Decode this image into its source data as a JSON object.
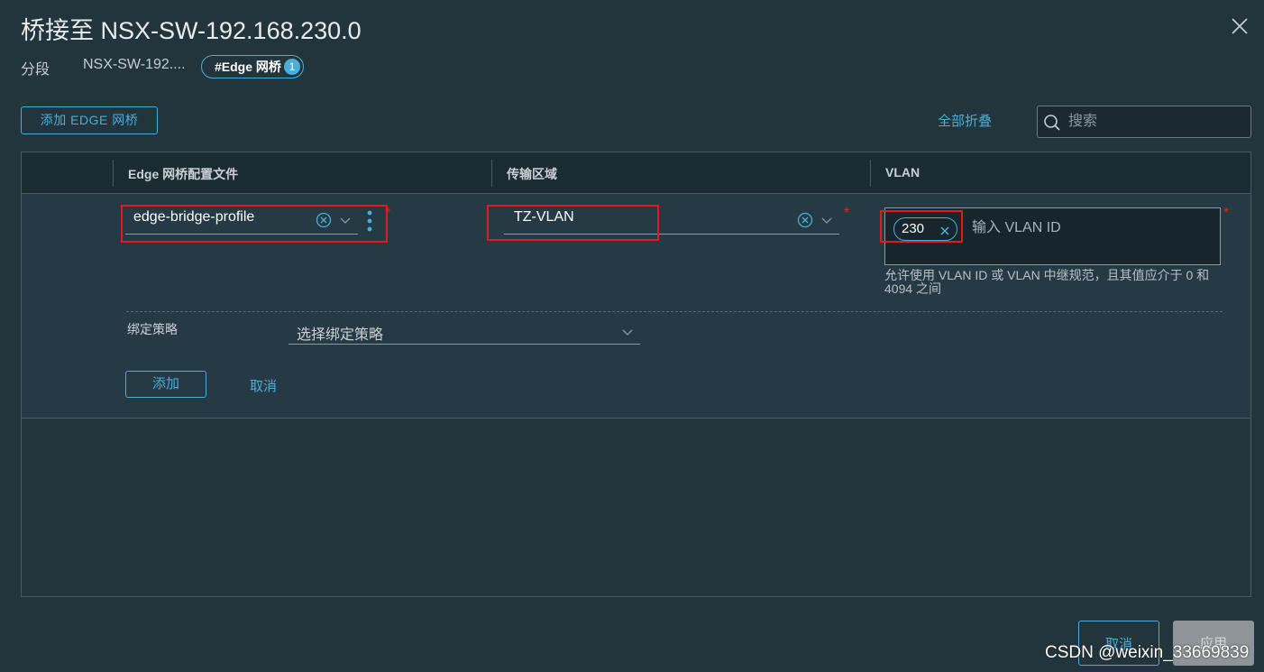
{
  "dialog": {
    "title": "桥接至 NSX-SW-192.168.230.0",
    "close_icon": "close-icon"
  },
  "breadcrumb": {
    "segment_label": "分段",
    "segment_name": "NSX-SW-192....",
    "tab_label": "#Edge 网桥",
    "tab_count": "1"
  },
  "toolbar": {
    "add_bridge_label": "添加 EDGE 网桥",
    "collapse_all_label": "全部折叠",
    "search_placeholder": "搜索"
  },
  "grid": {
    "columns": [
      "Edge 网桥配置文件",
      "传输区域",
      "VLAN"
    ]
  },
  "form": {
    "edge_profile_value": "edge-bridge-profile",
    "transport_zone_value": "TZ-VLAN",
    "vlan_tag": "230",
    "vlan_placeholder": "输入 VLAN ID",
    "vlan_help": "允许使用 VLAN ID 或 VLAN 中继规范，且其值应介于 0 和 4094 之间",
    "binding_policy_label": "绑定策略",
    "binding_policy_placeholder": "选择绑定策略",
    "add_label": "添加",
    "cancel_label": "取消",
    "required_mark": "*"
  },
  "footer": {
    "cancel_label": "取消",
    "apply_label": "应用"
  },
  "watermark": "CSDN @weixin_33669839",
  "colors": {
    "accent": "#49afd9",
    "background": "#22343c",
    "required": "#e62700",
    "highlight_box": "#e41a1a"
  }
}
